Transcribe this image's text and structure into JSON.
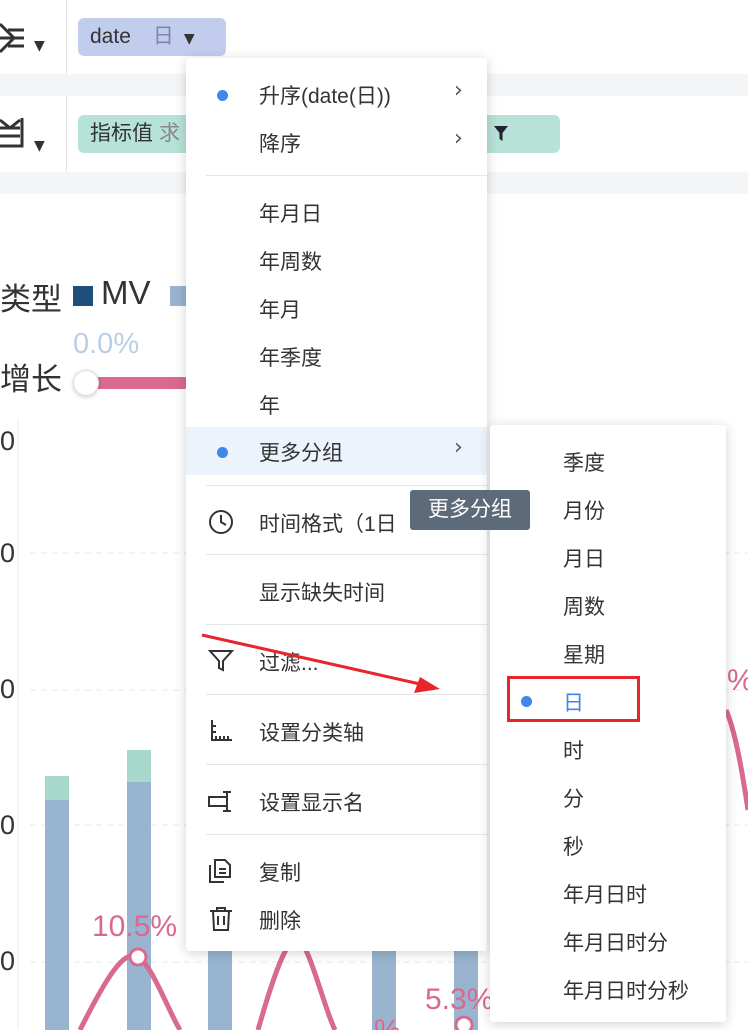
{
  "shelf": {
    "row1_icon": "columns-shelf-icon",
    "row2_icon": "rows-shelf-icon",
    "date_pill": {
      "field": "date",
      "granularity": "日"
    },
    "metric_pill": {
      "label": "指标值",
      "cut": "求"
    }
  },
  "legend": {
    "type_label": "类型",
    "mv_label": "MV",
    "growth_label": "增长",
    "slider_value": "0.0%",
    "colors": {
      "mv": "#1f4e79",
      "series_b": "#98b4cf",
      "series_c": "#a6d9cb",
      "line": "#d9698f"
    }
  },
  "chart": {
    "y_tick_labels": [
      "0",
      "0",
      "0",
      "0",
      "0"
    ],
    "data_labels": [
      "10.5%",
      "5.3%",
      "%",
      "%"
    ]
  },
  "menu": {
    "sort_asc": "升序(date(日))",
    "sort_desc": "降序",
    "groups": [
      "年月日",
      "年周数",
      "年月",
      "年季度",
      "年"
    ],
    "more_groups": "更多分组",
    "time_format": "时间格式（1日",
    "show_missing": "显示缺失时间",
    "filter": "过滤...",
    "set_axis": "设置分类轴",
    "set_display_name": "设置显示名",
    "copy": "复制",
    "delete": "删除"
  },
  "submenu": {
    "items": [
      "季度",
      "月份",
      "月日",
      "周数",
      "星期",
      "日",
      "时",
      "分",
      "秒",
      "年月日时",
      "年月日时分",
      "年月日时分秒"
    ],
    "selected": "日"
  },
  "tooltip": "更多分组"
}
